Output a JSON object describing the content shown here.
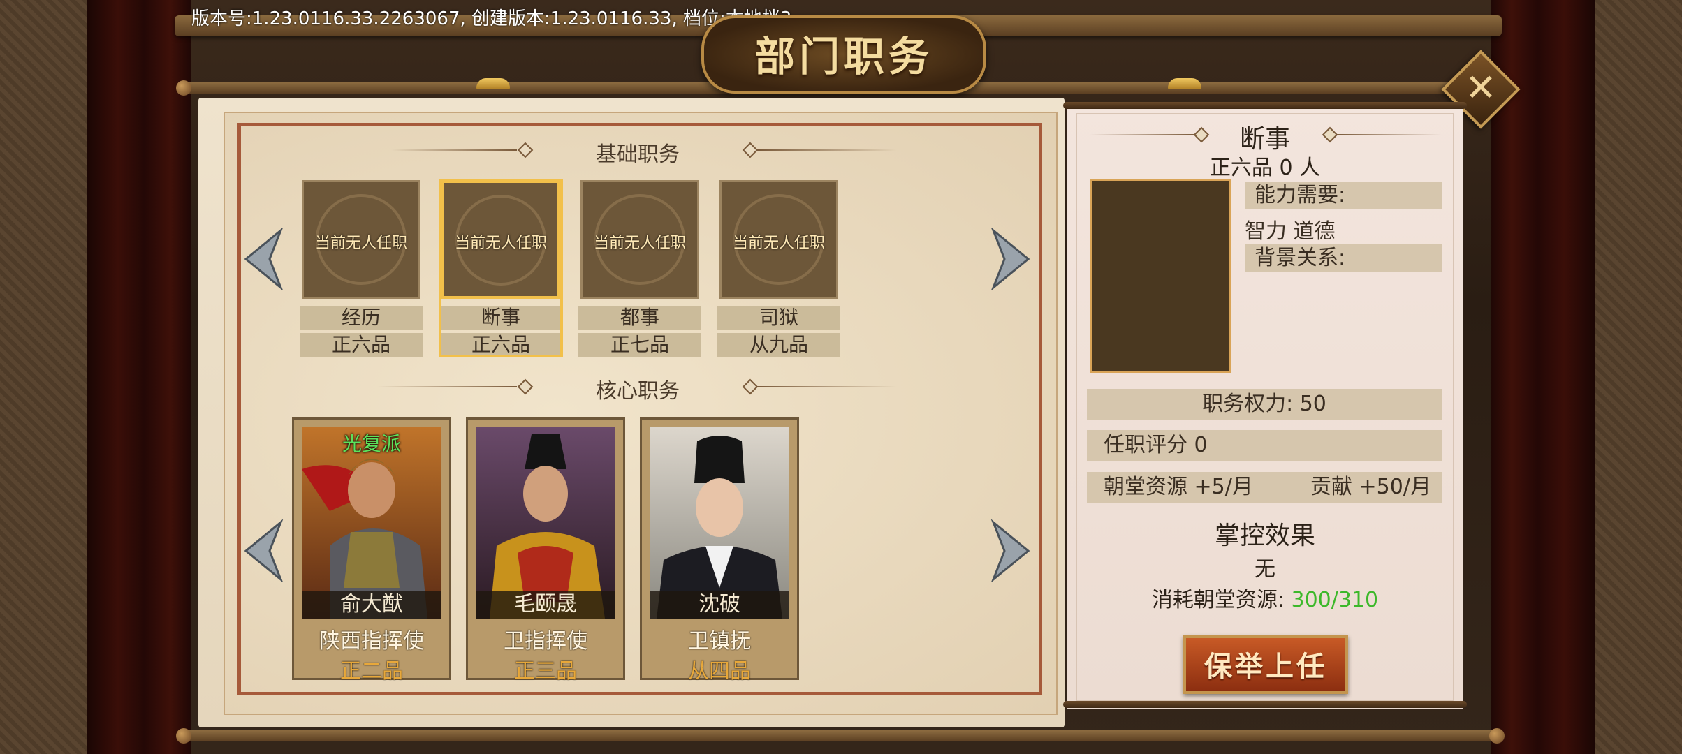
{
  "version_text": "版本号:1.23.0116.33.2263067,  创建版本:1.23.0116.33, 档位:本地档3",
  "title": "部门职务",
  "basic_section": {
    "title": "基础职务",
    "posts": [
      {
        "vacant": "当前无人任职",
        "name": "经历",
        "rank": "正六品",
        "selected": false
      },
      {
        "vacant": "当前无人任职",
        "name": "断事",
        "rank": "正六品",
        "selected": true
      },
      {
        "vacant": "当前无人任职",
        "name": "都事",
        "rank": "正七品",
        "selected": false
      },
      {
        "vacant": "当前无人任职",
        "name": "司狱",
        "rank": "从九品",
        "selected": false
      }
    ]
  },
  "core_section": {
    "title": "核心职务",
    "officers": [
      {
        "faction": "光复派",
        "name": "俞大猷",
        "post": "陕西指挥使",
        "rank": "正二品"
      },
      {
        "faction": "",
        "name": "毛颐晟",
        "post": "卫指挥使",
        "rank": "正三品"
      },
      {
        "faction": "",
        "name": "沈破",
        "post": "卫镇抚",
        "rank": "从四品"
      }
    ]
  },
  "detail": {
    "post_name": "断事",
    "rank_count": "正六品 0 人",
    "ability_label": "能力需要:",
    "ability_value": "智力 道德",
    "background_label": "背景关系:",
    "power": "职务权力: 50",
    "rating": "任职评分   0",
    "resource": "朝堂资源 +5/月",
    "contribution": "贡献 +50/月",
    "control_title": "掌控效果",
    "control_value": "无",
    "consume_label": "消耗朝堂资源: ",
    "consume_value": "300/310",
    "nominate_button": "保举上任"
  },
  "colors": {
    "accent_gold": "#f2c04a",
    "rank_orange": "#e8a83a",
    "faction_green": "#5ce25c",
    "resource_green": "#3cb82a",
    "button_red": "#b0451c"
  }
}
